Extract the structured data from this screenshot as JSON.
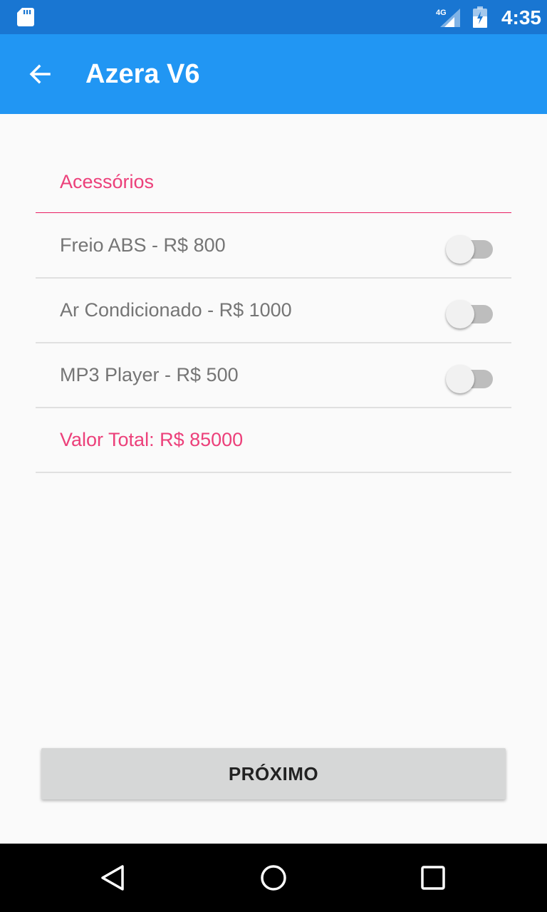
{
  "status_bar": {
    "time": "4:35",
    "network": "4G",
    "icons": [
      "sd-card-icon",
      "signal-icon",
      "battery-icon"
    ]
  },
  "app_bar": {
    "title": "Azera V6",
    "back_icon": "arrow-back-icon",
    "background": "#2196f3"
  },
  "accessories": {
    "header": "Acessórios",
    "items": [
      {
        "label": "Freio ABS - R$ 800",
        "checked": false
      },
      {
        "label": "Ar Condicionado - R$ 1000",
        "checked": false
      },
      {
        "label": "MP3 Player - R$ 500",
        "checked": false
      }
    ]
  },
  "total": {
    "label": "Valor Total: R$ 85000"
  },
  "next_button": {
    "label": "PRÓXIMO"
  },
  "nav_bar": {
    "icons": [
      "nav-back-icon",
      "nav-home-icon",
      "nav-recents-icon"
    ]
  },
  "colors": {
    "accent": "#ec407a",
    "primary": "#2196f3",
    "primary_dark": "#1976d2"
  }
}
